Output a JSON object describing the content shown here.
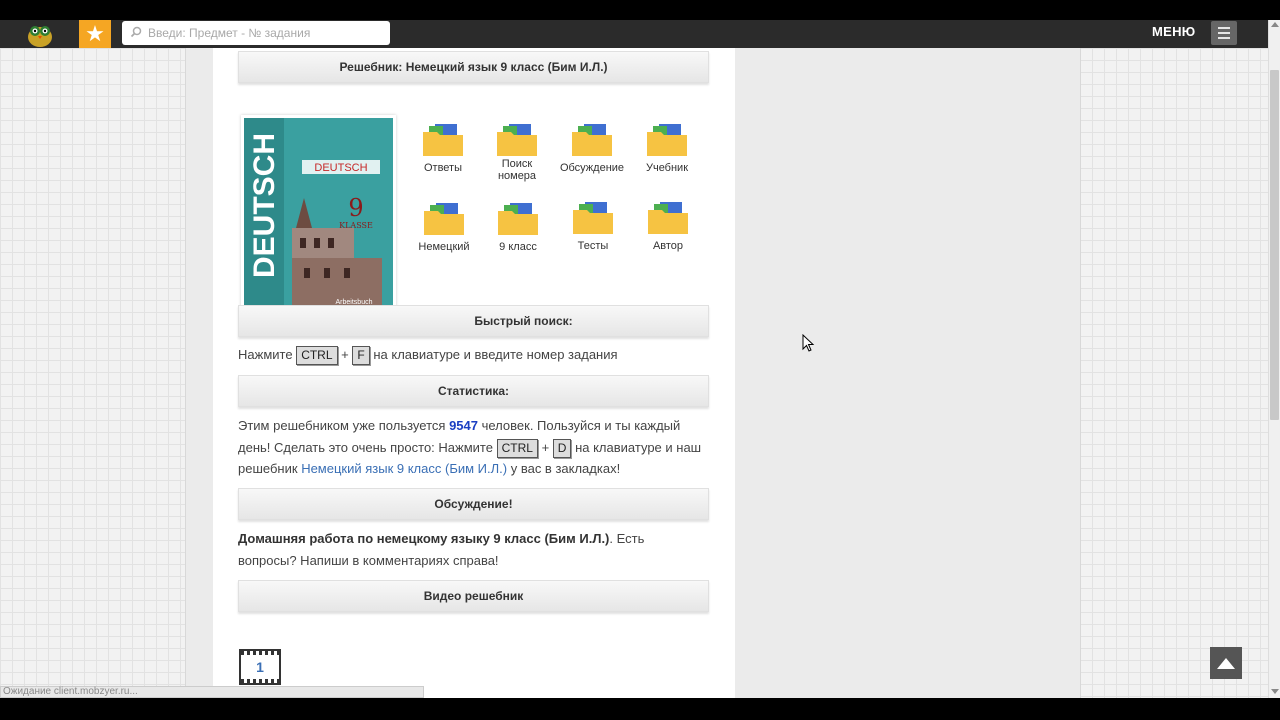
{
  "header": {
    "search_placeholder": "Введи: Предмет - № задания",
    "menu_label": "МЕНЮ"
  },
  "sections": {
    "title": "Решебник: Немецкий язык 9 класс (Бим И.Л.)",
    "quick_search": "Быстрый поиск:",
    "statistics": "Статистика:",
    "discussion": "Обсуждение!",
    "video": "Видео решебник"
  },
  "cover": {
    "title": "DEUTSCH",
    "grade": "9",
    "klasse": "KLASSE",
    "subtitle": "Arbeitsbuch"
  },
  "folders": [
    {
      "label": "Ответы"
    },
    {
      "label": "Поиск номера"
    },
    {
      "label": "Обсуждение"
    },
    {
      "label": "Учебник"
    },
    {
      "label": "Немецкий"
    },
    {
      "label": "9 класс"
    },
    {
      "label": "Тесты"
    },
    {
      "label": "Автор"
    }
  ],
  "quick_search_text": {
    "before": "Нажмите",
    "key1": "CTRL",
    "plus": "+",
    "key2": "F",
    "after": "на клавиатуре и введите номер задания"
  },
  "stats_text": {
    "part1": "Этим решебником уже пользуется",
    "count": "9547",
    "part2": "человек. Пользуйся и ты каждый день! Сделать это очень просто: Нажмите",
    "key1": "CTRL",
    "plus": "+",
    "key2": "D",
    "part3": "на клавиатуре и наш решебник",
    "link": "Немецкий язык 9 класс (Бим И.Л.)",
    "part4": "у вас в закладках!"
  },
  "discussion_text": {
    "bold": "Домашняя работа по немецкому языку 9 класс (Бим И.Л.)",
    "rest": ". Есть вопросы? Напиши в комментариях справа!"
  },
  "video_page": "1",
  "status_bar": "Ожидание client.mobzyer.ru..."
}
